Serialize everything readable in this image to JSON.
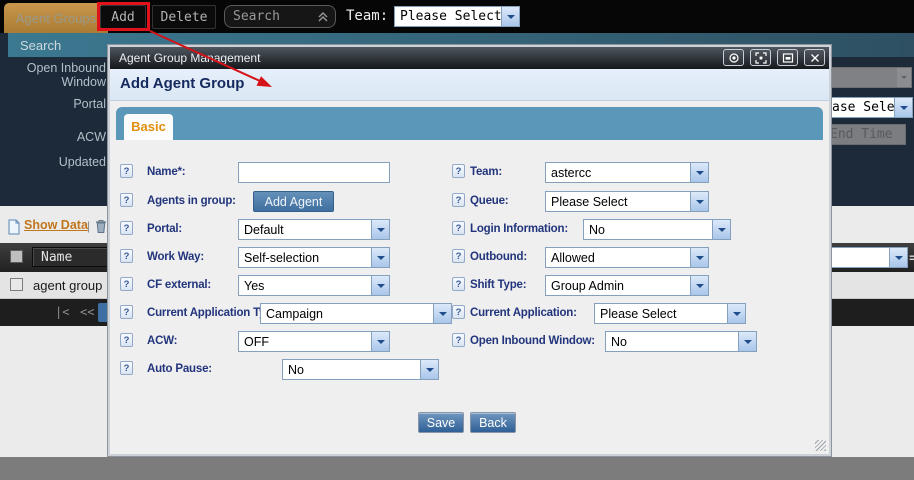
{
  "topbar": {
    "tab_label": "Agent Groups",
    "add_label": "Add",
    "delete_label": "Delete",
    "search_value": "Search",
    "team_label": "Team:",
    "team_value": "Please Select"
  },
  "background": {
    "panel_title": "Search",
    "field_labels": {
      "open_inbound_window": "Open Inbound Window",
      "portal": "Portal",
      "acw": "ACW",
      "updated": "Updated"
    },
    "fragments": {
      "portal_select_value": "ase Select",
      "end_time_placeholder": "End Time",
      "filter_equals": "="
    },
    "toolbar": {
      "show_data_label": "Show Data",
      "divider": "|"
    },
    "table": {
      "name_header": "Name",
      "row_name": "agent group"
    },
    "pagination": {
      "first": "|<",
      "prev": "<<"
    }
  },
  "dialog": {
    "title": "Agent Group Management",
    "heading": "Add Agent Group",
    "tab_basic": "Basic",
    "help_glyph": "?",
    "fields_left": [
      {
        "label": "Name*:",
        "value": ""
      },
      {
        "label": "Agents in group:",
        "button": "Add Agent"
      },
      {
        "label": "Portal:",
        "value": "Default"
      },
      {
        "label": "Work Way:",
        "value": "Self-selection"
      },
      {
        "label": "CF external:",
        "value": "Yes"
      },
      {
        "label": "Current Application Type:",
        "value": "Campaign"
      },
      {
        "label": "ACW:",
        "value": "OFF"
      },
      {
        "label": "Auto Pause:",
        "value": "No"
      }
    ],
    "fields_right": [
      {
        "label": "Team:",
        "value": "astercc"
      },
      {
        "label": "Queue:",
        "value": "Please Select"
      },
      {
        "label": "Login Information:",
        "value": "No"
      },
      {
        "label": "Outbound:",
        "value": "Allowed"
      },
      {
        "label": "Shift Type:",
        "value": "Group Admin"
      },
      {
        "label": "Current Application:",
        "value": "Please Select"
      },
      {
        "label": "Open Inbound Window:",
        "value": "No"
      }
    ],
    "save_label": "Save",
    "back_label": "Back"
  }
}
